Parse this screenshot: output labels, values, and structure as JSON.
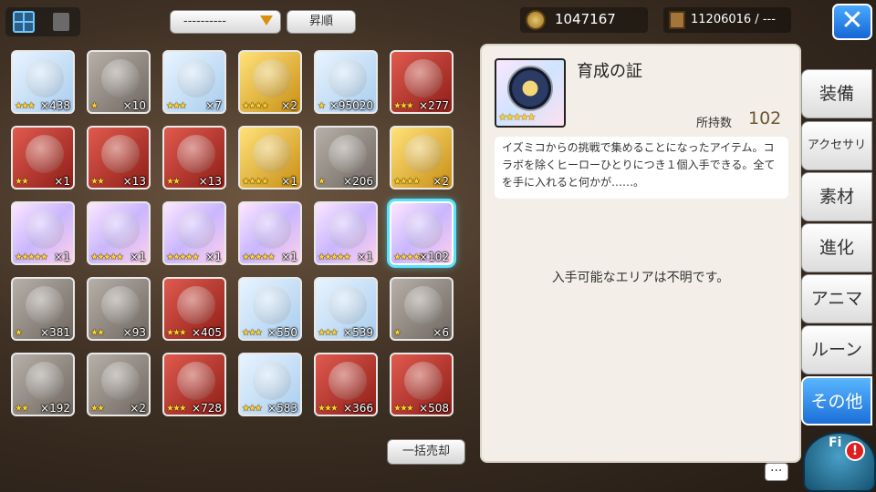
{
  "top": {
    "sort_select": "----------",
    "sort_order": "昇順",
    "gold": "1047167",
    "tickets": "11206016 / ---",
    "close": "✕"
  },
  "items": [
    {
      "color": "c-blue",
      "stars": "★★★",
      "qty": "×438"
    },
    {
      "color": "c-gray",
      "stars": "★",
      "qty": "×10"
    },
    {
      "color": "c-blue",
      "stars": "★★★",
      "qty": "×7"
    },
    {
      "color": "c-gold",
      "stars": "★★★★",
      "qty": "×2"
    },
    {
      "color": "c-blue",
      "stars": "★",
      "qty": "×95020"
    },
    {
      "color": "c-red",
      "stars": "★★★",
      "qty": "×277"
    },
    {
      "color": "c-red",
      "stars": "★★",
      "qty": "×1"
    },
    {
      "color": "c-red",
      "stars": "★★",
      "qty": "×13"
    },
    {
      "color": "c-red",
      "stars": "★★",
      "qty": "×13"
    },
    {
      "color": "c-gold",
      "stars": "★★★★",
      "qty": "×1"
    },
    {
      "color": "c-gray",
      "stars": "★",
      "qty": "×206"
    },
    {
      "color": "c-gold",
      "stars": "★★★★",
      "qty": "×2"
    },
    {
      "color": "c-pink",
      "stars": "★★★★★",
      "qty": "×1"
    },
    {
      "color": "c-pink",
      "stars": "★★★★★",
      "qty": "×1"
    },
    {
      "color": "c-pink",
      "stars": "★★★★★",
      "qty": "×1"
    },
    {
      "color": "c-pink",
      "stars": "★★★★★",
      "qty": "×1"
    },
    {
      "color": "c-pink",
      "stars": "★★★★★",
      "qty": "×1"
    },
    {
      "color": "c-pink",
      "stars": "★★★★★",
      "qty": "×102",
      "selected": true
    },
    {
      "color": "c-gray",
      "stars": "★",
      "qty": "×381"
    },
    {
      "color": "c-gray",
      "stars": "★★",
      "qty": "×93"
    },
    {
      "color": "c-red",
      "stars": "★★★",
      "qty": "×405"
    },
    {
      "color": "c-blue",
      "stars": "★★★",
      "qty": "×550"
    },
    {
      "color": "c-blue",
      "stars": "★★★",
      "qty": "×539"
    },
    {
      "color": "c-gray",
      "stars": "★",
      "qty": "×6"
    },
    {
      "color": "c-gray",
      "stars": "★★",
      "qty": "×192"
    },
    {
      "color": "c-gray",
      "stars": "★★",
      "qty": "×2"
    },
    {
      "color": "c-red",
      "stars": "★★★",
      "qty": "×728"
    },
    {
      "color": "c-blue",
      "stars": "★★★",
      "qty": "×583"
    },
    {
      "color": "c-red",
      "stars": "★★★",
      "qty": "×366"
    },
    {
      "color": "c-red",
      "stars": "★★★",
      "qty": "×508"
    }
  ],
  "bulk_sell": "一括売却",
  "detail": {
    "name": "育成の証",
    "stars": "★★★★★",
    "owned_label": "所持数",
    "owned": "102",
    "description": "イズミコからの挑戦で集めることになったアイテム。コラボを除くヒーローひとりにつき１個入手できる。全てを手に入れると何かが……。",
    "area": "入手可能なエリアは不明です。"
  },
  "tabs": [
    {
      "label": "装備",
      "name": "tab-equipment"
    },
    {
      "label": "アクセサリ",
      "name": "tab-accessory",
      "small": true
    },
    {
      "label": "素材",
      "name": "tab-materials"
    },
    {
      "label": "進化",
      "name": "tab-evolution"
    },
    {
      "label": "アニマ",
      "name": "tab-anima"
    },
    {
      "label": "ルーン",
      "name": "tab-rune"
    },
    {
      "label": "その他",
      "name": "tab-other",
      "active": true
    }
  ],
  "mascot_label": "Fi",
  "alert": "!"
}
